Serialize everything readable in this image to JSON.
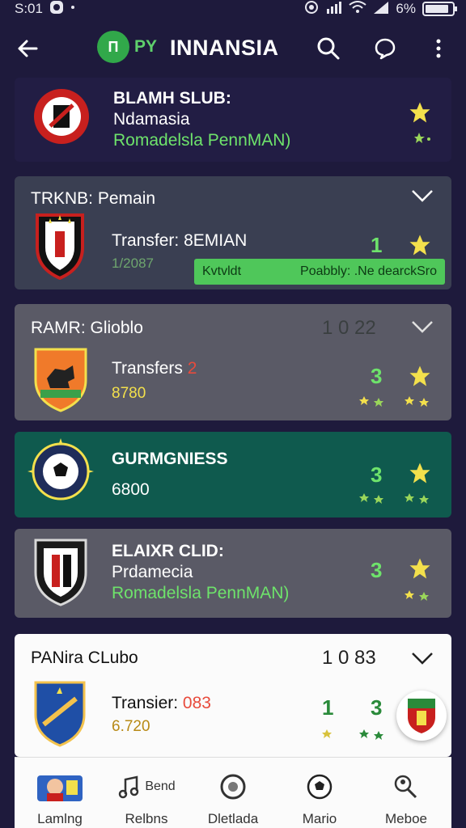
{
  "status_bar": {
    "time": "S:01",
    "battery": "6%"
  },
  "app_bar": {
    "brand": "PY",
    "brand_mark": "П",
    "title": "INNANSIA"
  },
  "cards": [
    {
      "line1": "BLAMH SLUB:",
      "line2": "Ndamasia",
      "line3": "Romadelsla PennMAN)"
    },
    {
      "title": "TRKNB: Pemain",
      "line1": "Transfer: 8EMIAN",
      "line2": "1/2087",
      "count": "1",
      "promo_left": "Kvtvldt",
      "promo_right": "Poabbly: .Ne dearckSro"
    },
    {
      "title": "RAMR: Glioblo",
      "score": "1 0 22",
      "line1": "Transfers",
      "line1_extra": "2",
      "line2": "8780",
      "count": "3"
    },
    {
      "line1": "GURMGNIESS",
      "line2": "6800",
      "count": "3"
    },
    {
      "line1": "ELAIXR CLID:",
      "line2": "Prdamecia",
      "line3": "Romadelsla PennMAN)",
      "count": "3"
    },
    {
      "title": "PANira CLubo",
      "score": "1 0 83",
      "line1": "Transier:",
      "line1_extra": "083",
      "line2": "6.720",
      "count1": "1",
      "count2": "3"
    }
  ],
  "bottom_nav": [
    {
      "label": "Lamlng",
      "icon": "player-avatar-icon"
    },
    {
      "label": "Relbns",
      "icon": "music-note-icon",
      "badge": "Bend"
    },
    {
      "label": "Dletlada",
      "icon": "disc-icon"
    },
    {
      "label": "Mario",
      "icon": "soccer-ball-icon"
    },
    {
      "label": "Meboe",
      "icon": "magnifier-people-icon"
    }
  ],
  "colors": {
    "accent": "#6ee36b",
    "star": "#f3e04c",
    "background": "#1e1a3c"
  }
}
